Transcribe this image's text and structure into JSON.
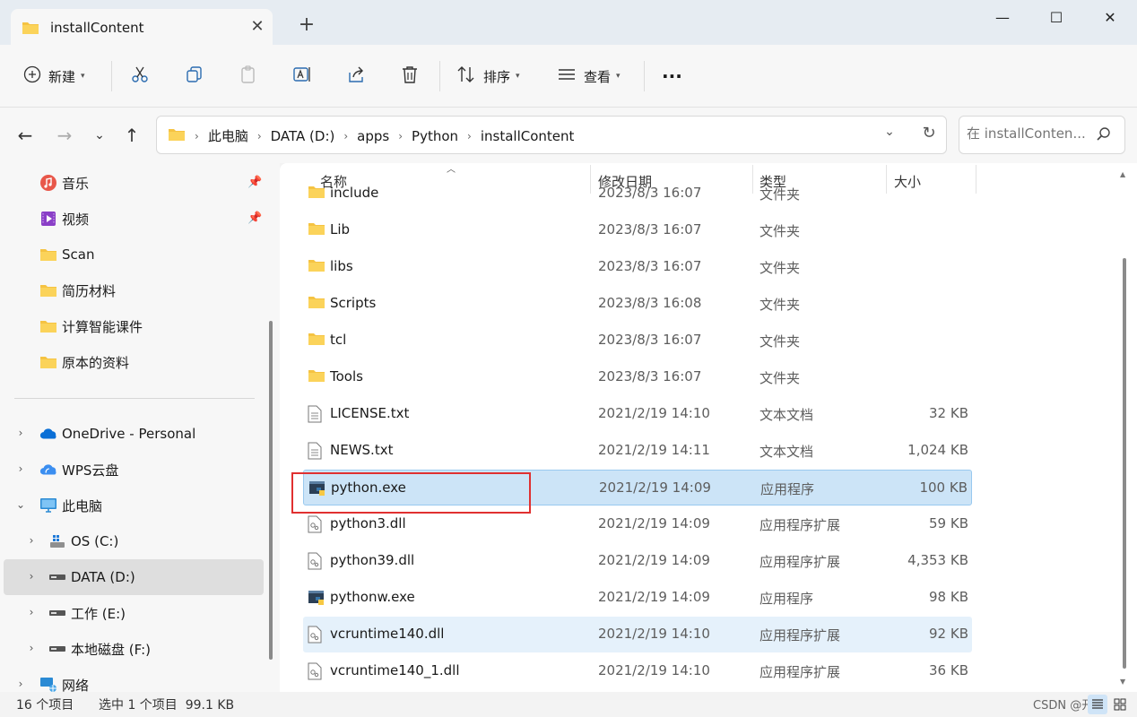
{
  "window": {
    "tab_title": "installContent",
    "new_tab": "+",
    "minimize": "—",
    "maximize": "☐",
    "close": "✕"
  },
  "toolbar": {
    "new_label": "新建",
    "sort_label": "排序",
    "view_label": "查看",
    "more_label": "···"
  },
  "address": {
    "crumbs": [
      "此电脑",
      "DATA (D:)",
      "apps",
      "Python",
      "installContent"
    ],
    "search_placeholder": "在 installConten..."
  },
  "sidebar": {
    "quick_access": [
      {
        "label": "音乐",
        "icon": "music-icon",
        "pinned": true
      },
      {
        "label": "视频",
        "icon": "video-icon",
        "pinned": true
      },
      {
        "label": "Scan",
        "icon": "folder-icon"
      },
      {
        "label": "简历材料",
        "icon": "folder-icon"
      },
      {
        "label": "计算智能课件",
        "icon": "folder-icon"
      },
      {
        "label": "原本的资料",
        "icon": "folder-icon"
      }
    ],
    "locations": [
      {
        "label": "OneDrive - Personal",
        "icon": "onedrive-icon",
        "expander": "›"
      },
      {
        "label": "WPS云盘",
        "icon": "wps-cloud-icon",
        "expander": "›"
      },
      {
        "label": "此电脑",
        "icon": "pc-icon",
        "expander": "⌄"
      },
      {
        "label": "OS (C:)",
        "icon": "os-drive-icon",
        "expander": "›"
      },
      {
        "label": "DATA (D:)",
        "icon": "drive-icon",
        "expander": "›",
        "selected": true
      },
      {
        "label": "工作 (E:)",
        "icon": "drive-icon",
        "expander": "›"
      },
      {
        "label": "本地磁盘 (F:)",
        "icon": "drive-icon",
        "expander": "›"
      },
      {
        "label": "网络",
        "icon": "network-icon",
        "expander": "›"
      }
    ]
  },
  "columns": {
    "name": "名称",
    "date": "修改日期",
    "type": "类型",
    "size": "大小"
  },
  "files": [
    {
      "name": "include",
      "date": "2023/8/3 16:07",
      "type": "文件夹",
      "size": "",
      "icon": "folder-icon"
    },
    {
      "name": "Lib",
      "date": "2023/8/3 16:07",
      "type": "文件夹",
      "size": "",
      "icon": "folder-icon"
    },
    {
      "name": "libs",
      "date": "2023/8/3 16:07",
      "type": "文件夹",
      "size": "",
      "icon": "folder-icon"
    },
    {
      "name": "Scripts",
      "date": "2023/8/3 16:08",
      "type": "文件夹",
      "size": "",
      "icon": "folder-icon"
    },
    {
      "name": "tcl",
      "date": "2023/8/3 16:07",
      "type": "文件夹",
      "size": "",
      "icon": "folder-icon"
    },
    {
      "name": "Tools",
      "date": "2023/8/3 16:07",
      "type": "文件夹",
      "size": "",
      "icon": "folder-icon"
    },
    {
      "name": "LICENSE.txt",
      "date": "2021/2/19 14:10",
      "type": "文本文档",
      "size": "32 KB",
      "icon": "text-file-icon"
    },
    {
      "name": "NEWS.txt",
      "date": "2021/2/19 14:11",
      "type": "文本文档",
      "size": "1,024 KB",
      "icon": "text-file-icon"
    },
    {
      "name": "python.exe",
      "date": "2021/2/19 14:09",
      "type": "应用程序",
      "size": "100 KB",
      "icon": "python-exe-icon",
      "selected": true
    },
    {
      "name": "python3.dll",
      "date": "2021/2/19 14:09",
      "type": "应用程序扩展",
      "size": "59 KB",
      "icon": "dll-file-icon"
    },
    {
      "name": "python39.dll",
      "date": "2021/2/19 14:09",
      "type": "应用程序扩展",
      "size": "4,353 KB",
      "icon": "dll-file-icon"
    },
    {
      "name": "pythonw.exe",
      "date": "2021/2/19 14:09",
      "type": "应用程序",
      "size": "98 KB",
      "icon": "python-exe-icon"
    },
    {
      "name": "vcruntime140.dll",
      "date": "2021/2/19 14:10",
      "type": "应用程序扩展",
      "size": "92 KB",
      "icon": "dll-file-icon",
      "hover": true
    },
    {
      "name": "vcruntime140_1.dll",
      "date": "2021/2/19 14:10",
      "type": "应用程序扩展",
      "size": "36 KB",
      "icon": "dll-file-icon"
    }
  ],
  "status": {
    "item_count": "16 个项目",
    "selection": "选中 1 个项目  99.1 KB",
    "watermark": "CSDN @开朗"
  },
  "colors": {
    "accent": "#0067c0",
    "selected_row": "#cce4f7",
    "highlight_box": "#e03030",
    "folder": "#f5c342"
  }
}
